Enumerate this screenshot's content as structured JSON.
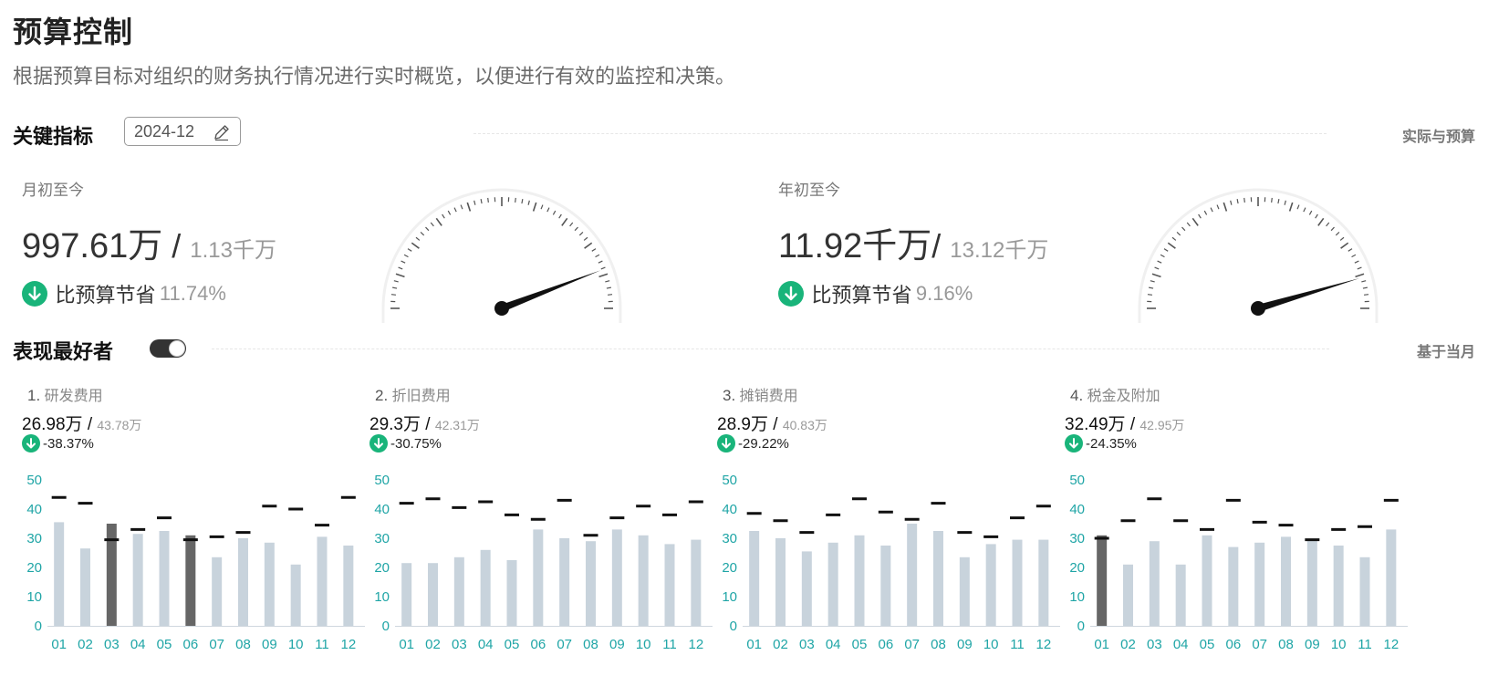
{
  "page": {
    "title": "预算控制",
    "description": "根据预算目标对组织的财务执行情况进行实时概览，以便进行有效的监控和决策。"
  },
  "key_metrics": {
    "title": "关键指标",
    "date": "2024-12",
    "right_label": "实际与预算",
    "items": [
      {
        "label": "月初至今",
        "actual": "997.61万",
        "separator": " / ",
        "budget": "1.13千万",
        "status_label": "比预算节省",
        "status_pct": "11.74%",
        "gauge_ratio": 0.883
      },
      {
        "label": "年初至今",
        "actual": "11.92千万",
        "separator": "/ ",
        "budget": "13.12千万",
        "status_label": "比预算节省",
        "status_pct": "9.16%",
        "gauge_ratio": 0.908
      }
    ]
  },
  "top_performers": {
    "title": "表现最好者",
    "right_label": "基于当月",
    "toggle_on": true
  },
  "colors": {
    "accent_green": "#19b47a",
    "bar_normal": "#c8d3dc",
    "bar_highlight": "#666666",
    "axis_teal": "#1fa5a6",
    "budget_marker": "#111111"
  },
  "chart_data": [
    {
      "type": "bar",
      "rank": "1.",
      "title": "研发费用",
      "actual": "26.98万",
      "budget": "43.78万",
      "change": "-38.37%",
      "categories": [
        "01",
        "02",
        "03",
        "04",
        "05",
        "06",
        "07",
        "08",
        "09",
        "10",
        "11",
        "12"
      ],
      "ylim": [
        0,
        50
      ],
      "yticks": [
        "0",
        "10",
        "20",
        "30",
        "40",
        "50"
      ],
      "series": [
        {
          "name": "actual",
          "values": [
            35.5,
            26.5,
            35,
            31.5,
            32.5,
            31,
            23.5,
            30,
            28.5,
            21,
            30.5,
            27.5
          ]
        },
        {
          "name": "budget",
          "values": [
            44,
            42,
            29.5,
            33,
            37,
            29.5,
            30.5,
            32,
            41,
            40,
            34.5,
            44
          ]
        }
      ],
      "highlight": [
        2,
        5
      ]
    },
    {
      "type": "bar",
      "rank": "2.",
      "title": "折旧费用",
      "actual": "29.3万",
      "budget": "42.31万",
      "change": "-30.75%",
      "categories": [
        "01",
        "02",
        "03",
        "04",
        "05",
        "06",
        "07",
        "08",
        "09",
        "10",
        "11",
        "12"
      ],
      "ylim": [
        0,
        50
      ],
      "yticks": [
        "0",
        "10",
        "20",
        "30",
        "40",
        "50"
      ],
      "series": [
        {
          "name": "actual",
          "values": [
            21.5,
            21.5,
            23.5,
            26,
            22.5,
            33,
            30,
            29,
            33,
            31,
            28,
            29.5
          ]
        },
        {
          "name": "budget",
          "values": [
            42,
            43.5,
            40.5,
            42.5,
            38,
            36.5,
            43,
            31,
            37,
            41,
            38,
            42.5
          ]
        }
      ],
      "highlight": []
    },
    {
      "type": "bar",
      "rank": "3.",
      "title": "摊销费用",
      "actual": "28.9万",
      "budget": "40.83万",
      "change": "-29.22%",
      "categories": [
        "01",
        "02",
        "03",
        "04",
        "05",
        "06",
        "07",
        "08",
        "09",
        "10",
        "11",
        "12"
      ],
      "ylim": [
        0,
        50
      ],
      "yticks": [
        "0",
        "10",
        "20",
        "30",
        "40",
        "50"
      ],
      "series": [
        {
          "name": "actual",
          "values": [
            32.5,
            30,
            25.5,
            28.5,
            31,
            27.5,
            35,
            32.5,
            23.5,
            28,
            29.5,
            29.5
          ]
        },
        {
          "name": "budget",
          "values": [
            38.5,
            36,
            32,
            38,
            43.5,
            39,
            36.5,
            42,
            32,
            30.5,
            37,
            41
          ]
        }
      ],
      "highlight": []
    },
    {
      "type": "bar",
      "rank": "4.",
      "title": "税金及附加",
      "actual": "32.49万",
      "budget": "42.95万",
      "change": "-24.35%",
      "categories": [
        "01",
        "02",
        "03",
        "04",
        "05",
        "06",
        "07",
        "08",
        "09",
        "10",
        "11",
        "12"
      ],
      "ylim": [
        0,
        50
      ],
      "yticks": [
        "0",
        "10",
        "20",
        "30",
        "40",
        "50"
      ],
      "series": [
        {
          "name": "actual",
          "values": [
            31,
            21,
            29,
            21,
            31,
            27,
            28.5,
            30.5,
            29.5,
            27.5,
            23.5,
            33
          ]
        },
        {
          "name": "budget",
          "values": [
            30,
            36,
            43.5,
            36,
            33,
            43,
            35.5,
            34.5,
            29.5,
            33,
            34,
            43
          ]
        }
      ],
      "highlight": [
        0
      ]
    }
  ]
}
